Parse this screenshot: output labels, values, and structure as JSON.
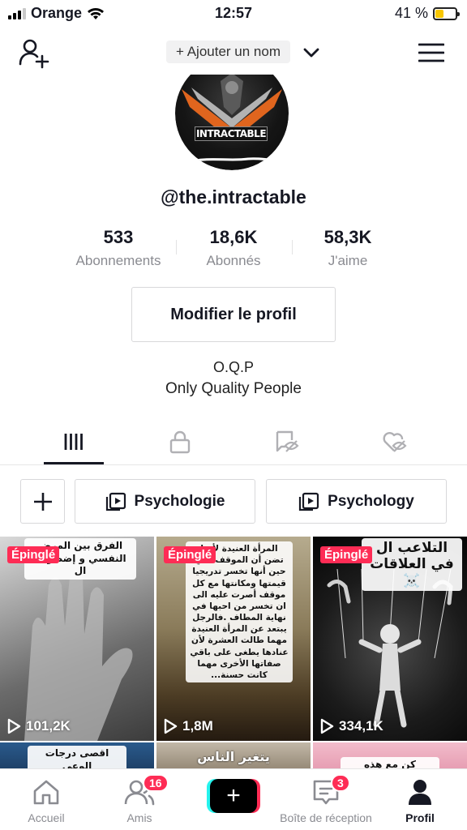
{
  "status_bar": {
    "carrier": "Orange",
    "time": "12:57",
    "battery": "41 %",
    "battery_level": 0.41
  },
  "header": {
    "add_name_label": "+ Ajouter un nom"
  },
  "profile": {
    "avatar_text": "INTRACTABLE",
    "username": "@the.intractable",
    "stats": [
      {
        "value": "533",
        "label": "Abonnements"
      },
      {
        "value": "18,6K",
        "label": "Abonnés"
      },
      {
        "value": "58,3K",
        "label": "J'aime"
      }
    ],
    "edit_button": "Modifier le profil",
    "bio_line1": "O.Q.P",
    "bio_line2": "Only Quality People"
  },
  "playlists": [
    {
      "label": "Psychologie"
    },
    {
      "label": "Psychology"
    }
  ],
  "videos": [
    {
      "pinned_label": "Épinglé",
      "views": "101,2K",
      "caption": "الفرق بين المرض النفسي و إضطراب ال"
    },
    {
      "pinned_label": "Épinglé",
      "views": "1,8M",
      "caption": "المرأة العنيدة لأنها تضن أن الموقف. في حين أنها تخسر تدريجيا قيمتها ومكانتها مع كل موقف أصرت عليه الى ان تخسر من احبها في نهاية المطاف .فالرجل يبتعد عن المرأة العنيدة مهما طالت العشرة لأن عنادها يطغى على باقي صفاتها الأخرى مهما كانت حسنة..."
    },
    {
      "pinned_label": "Épinglé",
      "views": "334,1K",
      "caption": "التلاعب ال في العلاقات ☠️"
    }
  ],
  "videos_row2": [
    {
      "caption": "اقصى درجات الوعي"
    },
    {
      "caption": "يتغير الناس"
    },
    {
      "caption": "كن مع هذه الكلمات"
    }
  ],
  "bottom_nav": {
    "home": "Accueil",
    "friends": "Amis",
    "friends_badge": "16",
    "inbox": "Boîte de réception",
    "inbox_badge": "3",
    "profile": "Profil"
  },
  "colors": {
    "accent": "#fe2c55",
    "text": "#161823",
    "muted": "#8a8b91",
    "cyan": "#25f4ee"
  }
}
